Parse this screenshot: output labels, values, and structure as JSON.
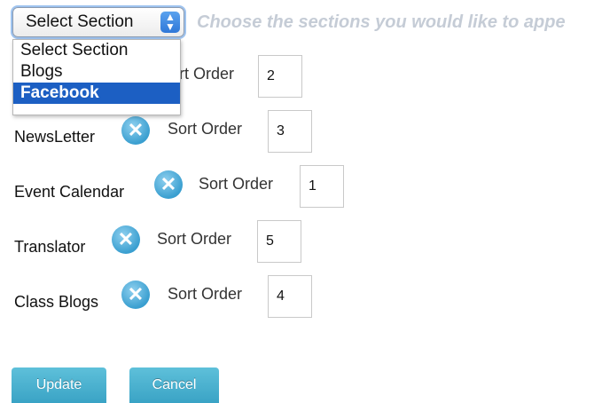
{
  "section_select": {
    "value": "Select Section",
    "hint": "Choose the sections you would like to appe",
    "options": [
      "Select Section",
      "Blogs",
      "Facebook"
    ],
    "highlighted_option": "Facebook"
  },
  "rows": [
    {
      "label": "",
      "sort_label": "rt Order",
      "value": "2"
    },
    {
      "label": "NewsLetter",
      "sort_label": "Sort Order",
      "value": "3"
    },
    {
      "label": "Event Calendar",
      "sort_label": "Sort Order",
      "value": "1"
    },
    {
      "label": "Translator",
      "sort_label": "Sort Order",
      "value": "5"
    },
    {
      "label": "Class Blogs",
      "sort_label": "Sort Order",
      "value": "4"
    }
  ],
  "buttons": {
    "update": "Update",
    "cancel": "Cancel"
  },
  "colors": {
    "button": "#3aa3c5",
    "remove_icon": "#3a9fd0",
    "highlight": "#1c5fc3"
  }
}
